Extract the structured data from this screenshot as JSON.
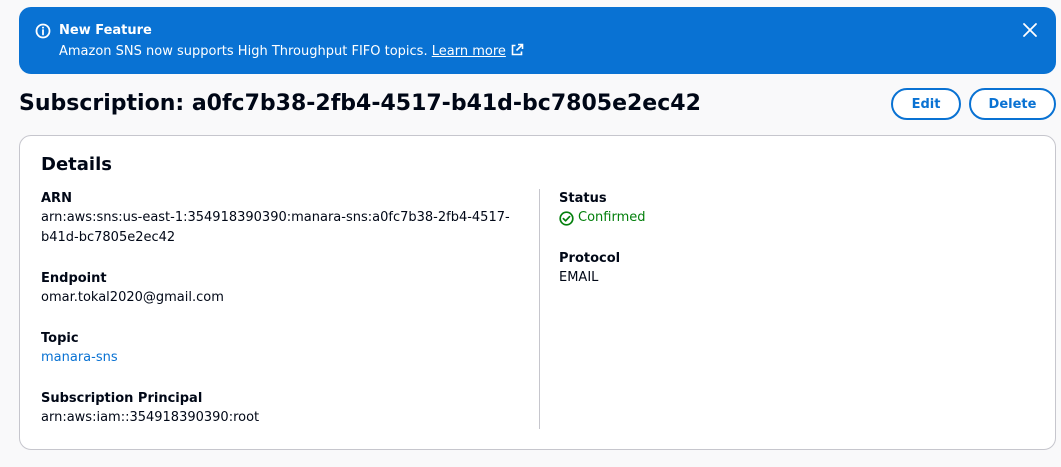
{
  "flash": {
    "title": "New Feature",
    "message": "Amazon SNS now supports High Throughput FIFO topics.",
    "link_label": "Learn more",
    "color": "#0972d3"
  },
  "header": {
    "title": "Subscription: a0fc7b38-2fb4-4517-b41d-bc7805e2ec42",
    "edit_label": "Edit",
    "delete_label": "Delete"
  },
  "details": {
    "title": "Details",
    "arn": {
      "label": "ARN",
      "value_line1": "arn:aws:sns:us-east-1:354918390390:manara-sns:a0fc7b38-2fb4-4517-",
      "value_line2": "b41d-bc7805e2ec42"
    },
    "endpoint": {
      "label": "Endpoint",
      "value": "omar.tokal2020@gmail.com"
    },
    "topic": {
      "label": "Topic",
      "value": "manara-sns"
    },
    "principal": {
      "label": "Subscription Principal",
      "value": "arn:aws:iam::354918390390:root"
    },
    "status": {
      "label": "Status",
      "value": "Confirmed",
      "color": "#037f0c"
    },
    "protocol": {
      "label": "Protocol",
      "value": "EMAIL"
    }
  }
}
